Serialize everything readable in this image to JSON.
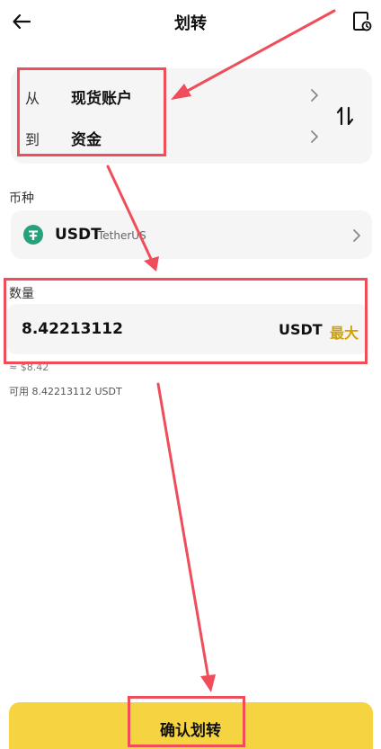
{
  "header": {
    "title": "划转",
    "back_icon": "arrow-left-icon",
    "history_icon": "history-icon"
  },
  "account": {
    "from_label": "从",
    "from_value": "现货账户",
    "to_label": "到",
    "to_value": "资金",
    "swap_icon": "swap-vertical-icon"
  },
  "coin": {
    "section_label": "币种",
    "symbol": "USDT",
    "name": "TetherUS",
    "icon": "usdt-icon"
  },
  "amount": {
    "section_label": "数量",
    "value": "8.42213112",
    "unit": "USDT",
    "max_label": "最大",
    "approx": "≈ $8.42",
    "available": "可用 8.42213112 USDT"
  },
  "actions": {
    "confirm_label": "确认划转"
  },
  "colors": {
    "accent": "#f6d341",
    "max_text": "#d4a200",
    "annotation": "#ef4d5a",
    "usdt": "#26a17b"
  }
}
